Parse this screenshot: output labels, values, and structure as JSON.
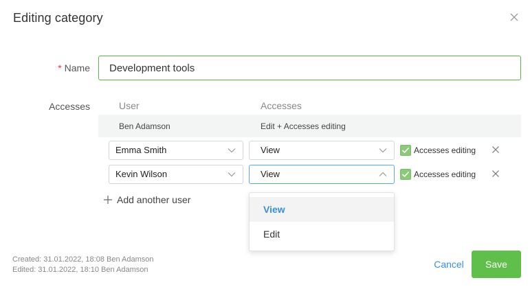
{
  "dialog": {
    "title": "Editing category",
    "close_icon": "close-icon"
  },
  "form": {
    "name_label": "Name",
    "name_required_mark": "*",
    "name_value": "Development tools",
    "accesses_label": "Accesses"
  },
  "accesses_table": {
    "headers": {
      "user": "User",
      "accesses": "Accesses"
    },
    "owner": {
      "user": "Ben Adamson",
      "accesses": "Edit + Accesses editing"
    },
    "rows": [
      {
        "user": "Emma Smith",
        "access": "View",
        "accesses_editing_label": "Accesses editing",
        "accesses_editing_checked": true
      },
      {
        "user": "Kevin Wilson",
        "access": "View",
        "accesses_editing_label": "Accesses editing",
        "accesses_editing_checked": true
      }
    ],
    "add_user_label": "Add another user"
  },
  "access_dropdown": {
    "open_for_row": 1,
    "options": [
      "View",
      "Edit"
    ],
    "selected": "View"
  },
  "meta": {
    "created": "Created:  31.01.2022, 18:08  Ben Adamson",
    "edited": "Edited:  31.01.2022, 18:10  Ben Adamson"
  },
  "footer": {
    "cancel_label": "Cancel",
    "save_label": "Save"
  },
  "colors": {
    "accent_green": "#5fbf4a",
    "link_blue": "#3a8ee0",
    "required_red": "#e53935",
    "owner_row_bg": "#f2f5f3"
  }
}
